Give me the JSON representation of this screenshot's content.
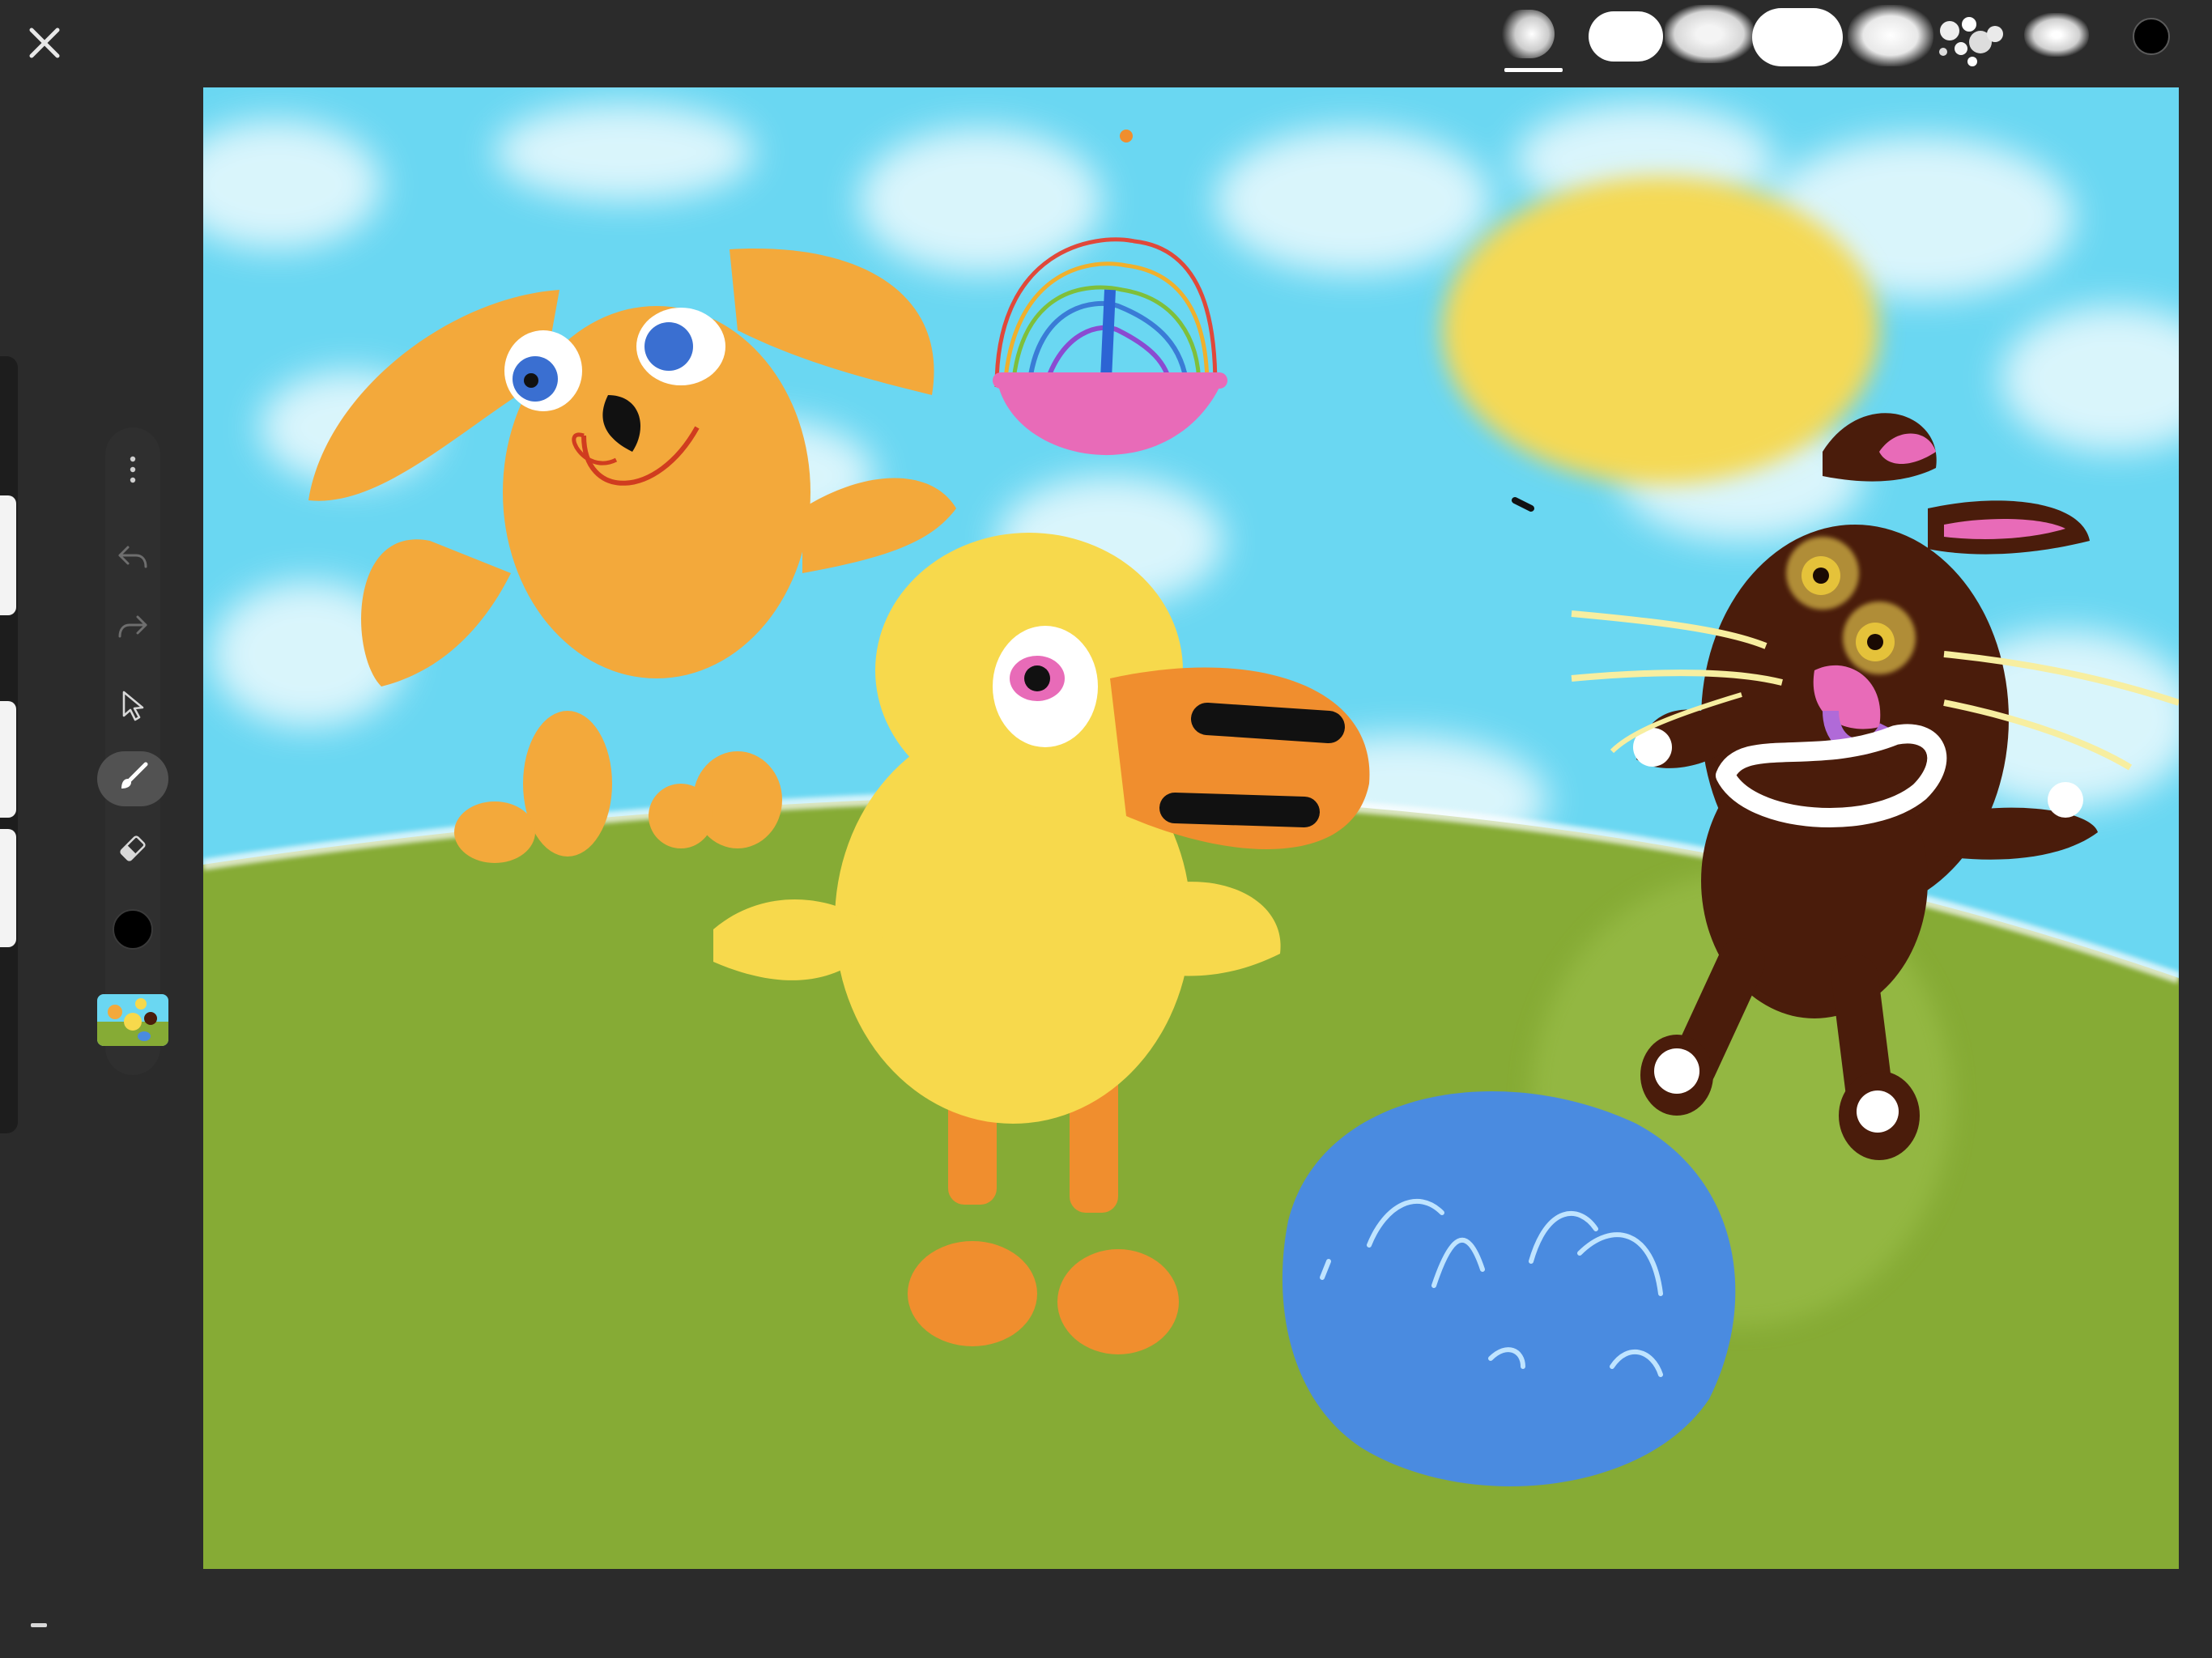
{
  "toolbar": {
    "close_icon": "close-icon",
    "brushes": [
      "soft-brush",
      "oval-brush",
      "chalk-brush",
      "round-brush",
      "airbrush",
      "splatter-brush",
      "pencil-brush"
    ],
    "selected_brush_index": 0,
    "current_color": "#000000"
  },
  "tools": {
    "items": [
      "more-icon",
      "undo-icon",
      "redo-icon",
      "select-icon",
      "brush-icon",
      "eraser-icon",
      "color-swatch",
      "layers-thumbnail"
    ],
    "active": "brush-icon",
    "undo_enabled": false,
    "redo_enabled": false
  },
  "canvas": {
    "sky_color": "#6ad7f2",
    "grass_color": "#86ab35",
    "subjects": [
      "orange-dog",
      "yellow-chick",
      "brown-bunny",
      "easter-basket",
      "sun",
      "blue-egg"
    ]
  }
}
